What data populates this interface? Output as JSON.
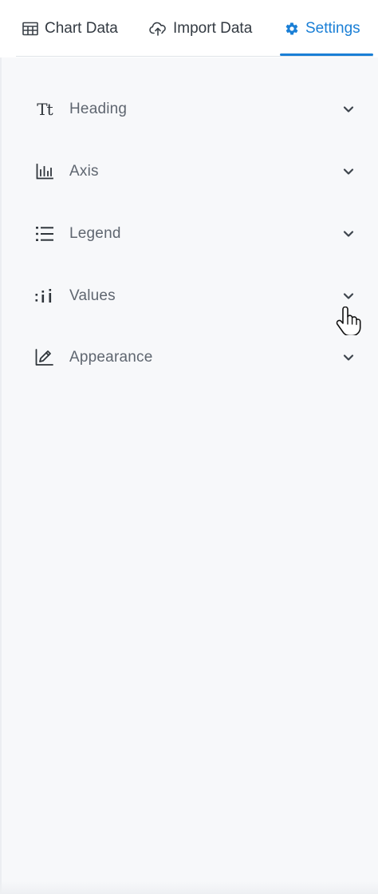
{
  "tabs": [
    {
      "label": "Chart Data",
      "icon": "table-icon",
      "active": false
    },
    {
      "label": "Import Data",
      "icon": "cloud-upload-icon",
      "active": false
    },
    {
      "label": "Settings",
      "icon": "gear-icon",
      "active": true
    }
  ],
  "colors": {
    "accent": "#1a7fd6",
    "text": "#333a42",
    "label": "#5f6670",
    "background": "#f7f8fa"
  },
  "sections": [
    {
      "label": "Heading",
      "icon": "text-size-icon"
    },
    {
      "label": "Axis",
      "icon": "axis-chart-icon"
    },
    {
      "label": "Legend",
      "icon": "list-icon"
    },
    {
      "label": "Values",
      "icon": "values-icon"
    },
    {
      "label": "Appearance",
      "icon": "edit-chart-icon"
    }
  ]
}
